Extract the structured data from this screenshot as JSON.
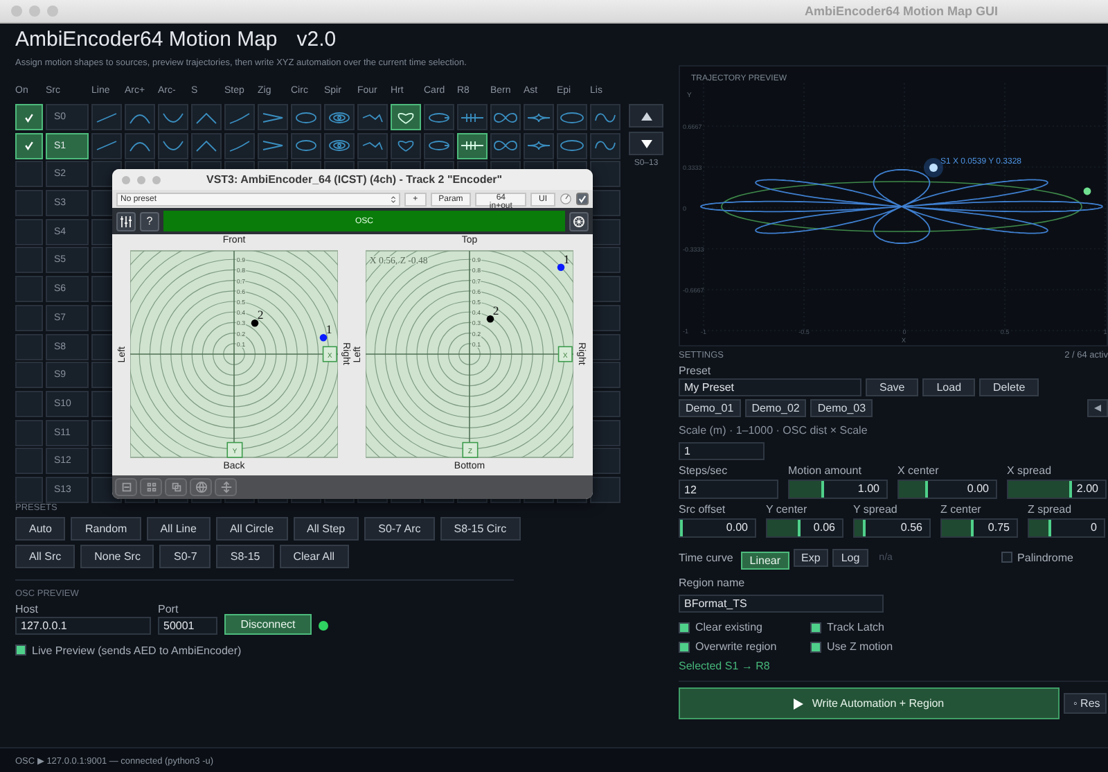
{
  "window": {
    "title": "AmbiEncoder64 Motion Map GUI"
  },
  "header": {
    "title": "AmbiEncoder64 Motion Map",
    "version": "v2.0",
    "subtitle": "Assign motion shapes to sources, preview trajectories, then write XYZ automation over the current time selection."
  },
  "grid": {
    "columns": [
      "On",
      "Src",
      "Line",
      "Arc+",
      "Arc-",
      "S",
      "Step",
      "Zig",
      "Circ",
      "Spir",
      "Four",
      "Hrt",
      "Card",
      "R8",
      "Bern",
      "Ast",
      "Epi",
      "Lis"
    ],
    "rows": [
      {
        "src": "S0",
        "on": true,
        "selected": false,
        "shapes": [
          {
            "selected": false
          },
          {
            "selected": false
          },
          {
            "selected": false
          },
          {
            "selected": false
          },
          {
            "selected": false
          },
          {
            "selected": false
          },
          {
            "selected": false
          },
          {
            "selected": false
          },
          {
            "selected": false
          },
          {
            "selected": true
          },
          {
            "selected": false
          },
          {
            "selected": false
          },
          {
            "selected": false
          },
          {
            "selected": false
          },
          {
            "selected": false
          },
          {
            "selected": false
          }
        ]
      },
      {
        "src": "S1",
        "on": true,
        "selected": true,
        "shapes": [
          {
            "selected": false
          },
          {
            "selected": false
          },
          {
            "selected": false
          },
          {
            "selected": false
          },
          {
            "selected": false
          },
          {
            "selected": false
          },
          {
            "selected": false
          },
          {
            "selected": false
          },
          {
            "selected": false
          },
          {
            "selected": false
          },
          {
            "selected": false
          },
          {
            "selected": true
          },
          {
            "selected": false
          },
          {
            "selected": false
          },
          {
            "selected": false
          },
          {
            "selected": false
          }
        ]
      },
      {
        "src": "S2",
        "on": false,
        "selected": false
      },
      {
        "src": "S3",
        "on": false,
        "selected": false
      },
      {
        "src": "S4",
        "on": false,
        "selected": false
      },
      {
        "src": "S5",
        "on": false,
        "selected": false
      },
      {
        "src": "S6",
        "on": false,
        "selected": false
      },
      {
        "src": "S7",
        "on": false,
        "selected": false
      },
      {
        "src": "S8",
        "on": false,
        "selected": false
      },
      {
        "src": "S9",
        "on": false,
        "selected": false
      },
      {
        "src": "S10",
        "on": false,
        "selected": false
      },
      {
        "src": "S11",
        "on": false,
        "selected": false
      },
      {
        "src": "S12",
        "on": false,
        "selected": false
      },
      {
        "src": "S13",
        "on": false,
        "selected": false
      }
    ],
    "range": "S0–13"
  },
  "presets": {
    "title": "PRESETS",
    "rows": [
      [
        "Auto",
        "Random",
        "All Line",
        "All Circle",
        "All Step",
        "S0-7 Arc",
        "S8-15 Circ"
      ],
      [
        "All Src",
        "None Src",
        "S0-7",
        "S8-15",
        "Clear All"
      ]
    ]
  },
  "osc_preview": {
    "title": "OSC PREVIEW",
    "host": {
      "label": "Host",
      "value": "127.0.0.1"
    },
    "port": {
      "label": "Port",
      "value": "50001"
    },
    "button": "Disconnect",
    "connected": true,
    "live_preview": {
      "label": "Live Preview (sends AED to AmbiEncoder)",
      "checked": true
    }
  },
  "status_bar": "OSC ▶ 127.0.0.1:9001 — connected (python3 -u)",
  "plugin": {
    "title": "VST3: AmbiEncoder_64 (ICST) (4ch) - Track 2 \"Encoder\"",
    "preset": "No preset",
    "buttons": [
      "+",
      "Param",
      "64 in+out",
      "UI"
    ],
    "enabled": true,
    "help": "?",
    "osc": "OSC",
    "pads": [
      {
        "top": "Front",
        "bottom": "Back",
        "left": "Left",
        "right": "Right",
        "x_handle": "X",
        "bottom_handle": "Y",
        "ring_labels": [
          "0.9",
          "0.8",
          "0.7",
          "0.6",
          "0.5",
          "0.4",
          "0.3",
          "0.2",
          "0.1"
        ],
        "sources": [
          {
            "label": "1",
            "color": "#0a1cff"
          },
          {
            "label": "2",
            "color": "#000000"
          }
        ]
      },
      {
        "top": "Top",
        "bottom": "Bottom",
        "left": "Left",
        "right": "Right",
        "readout": "X 0.56, Z -0.48",
        "x_handle": "X",
        "bottom_handle": "Z",
        "ring_labels": [
          "0.9",
          "0.8",
          "0.7",
          "0.6",
          "0.5",
          "0.4",
          "0.3",
          "0.2",
          "0.1"
        ],
        "sources": [
          {
            "label": "1",
            "color": "#0a1cff"
          },
          {
            "label": "2",
            "color": "#000000"
          }
        ]
      }
    ]
  },
  "trajectory_preview": {
    "title": "TRAJECTORY PREVIEW",
    "y_label": "Y",
    "x_label": "X",
    "y_ticks": [
      "0.6667",
      "0.3333",
      "0",
      "-0.3333",
      "-0.6667",
      "-1"
    ],
    "x_ticks": [
      "-1",
      "-0.5",
      "0",
      "0.5",
      "1"
    ],
    "cursor_label": "S1  X 0.0539  Y 0.3328"
  },
  "settings": {
    "title": "SETTINGS",
    "active_count": "2 / 64 activ",
    "preset": {
      "label": "Preset",
      "value": "My Preset",
      "buttons": [
        "Save",
        "Load",
        "Delete"
      ],
      "demos": [
        "Demo_01",
        "Demo_02",
        "Demo_03"
      ]
    },
    "scale": {
      "label": "Scale (m)  ·  1–1000  ·  OSC dist × Scale",
      "value": "1"
    },
    "controls": [
      [
        {
          "kind": "field",
          "label": "Steps/sec",
          "value": "12"
        },
        {
          "kind": "slider",
          "label": "Motion amount",
          "value": "1.00",
          "level": 0.35
        },
        {
          "kind": "slider",
          "label": "X center",
          "value": "0.00",
          "level": 0.3
        },
        {
          "kind": "slider",
          "label": "X spread",
          "value": "2.00",
          "level": 0.65
        }
      ],
      [
        {
          "kind": "slider",
          "label": "Src offset",
          "value": "0.00",
          "level": 0.0
        },
        {
          "kind": "slider",
          "label": "Y center",
          "value": "0.06",
          "level": 0.45
        },
        {
          "kind": "slider",
          "label": "Y spread",
          "value": "0.56",
          "level": 0.15
        },
        {
          "kind": "slider",
          "label": "Z center",
          "value": "0.75",
          "level": 0.43
        },
        {
          "kind": "slider",
          "label": "Z spread",
          "value": "0",
          "level": 0.3
        }
      ]
    ],
    "time_curve": {
      "label": "Time curve",
      "options": [
        {
          "label": "Linear",
          "selected": true
        },
        {
          "label": "Exp",
          "selected": false
        },
        {
          "label": "Log",
          "selected": false
        }
      ],
      "note": "n/a",
      "palindrome": {
        "label": "Palindrome",
        "checked": false
      }
    },
    "region": {
      "label": "Region name",
      "value": "BFormat_TS"
    },
    "options": [
      {
        "label": "Clear existing",
        "checked": true
      },
      {
        "label": "Track Latch",
        "checked": true
      },
      {
        "label": "Overwrite region",
        "checked": true
      },
      {
        "label": "Use Z motion",
        "checked": true
      }
    ],
    "selection": "Selected  S1 → R8",
    "write_button": "Write Automation + Region",
    "reset_button": "◦ Res"
  }
}
